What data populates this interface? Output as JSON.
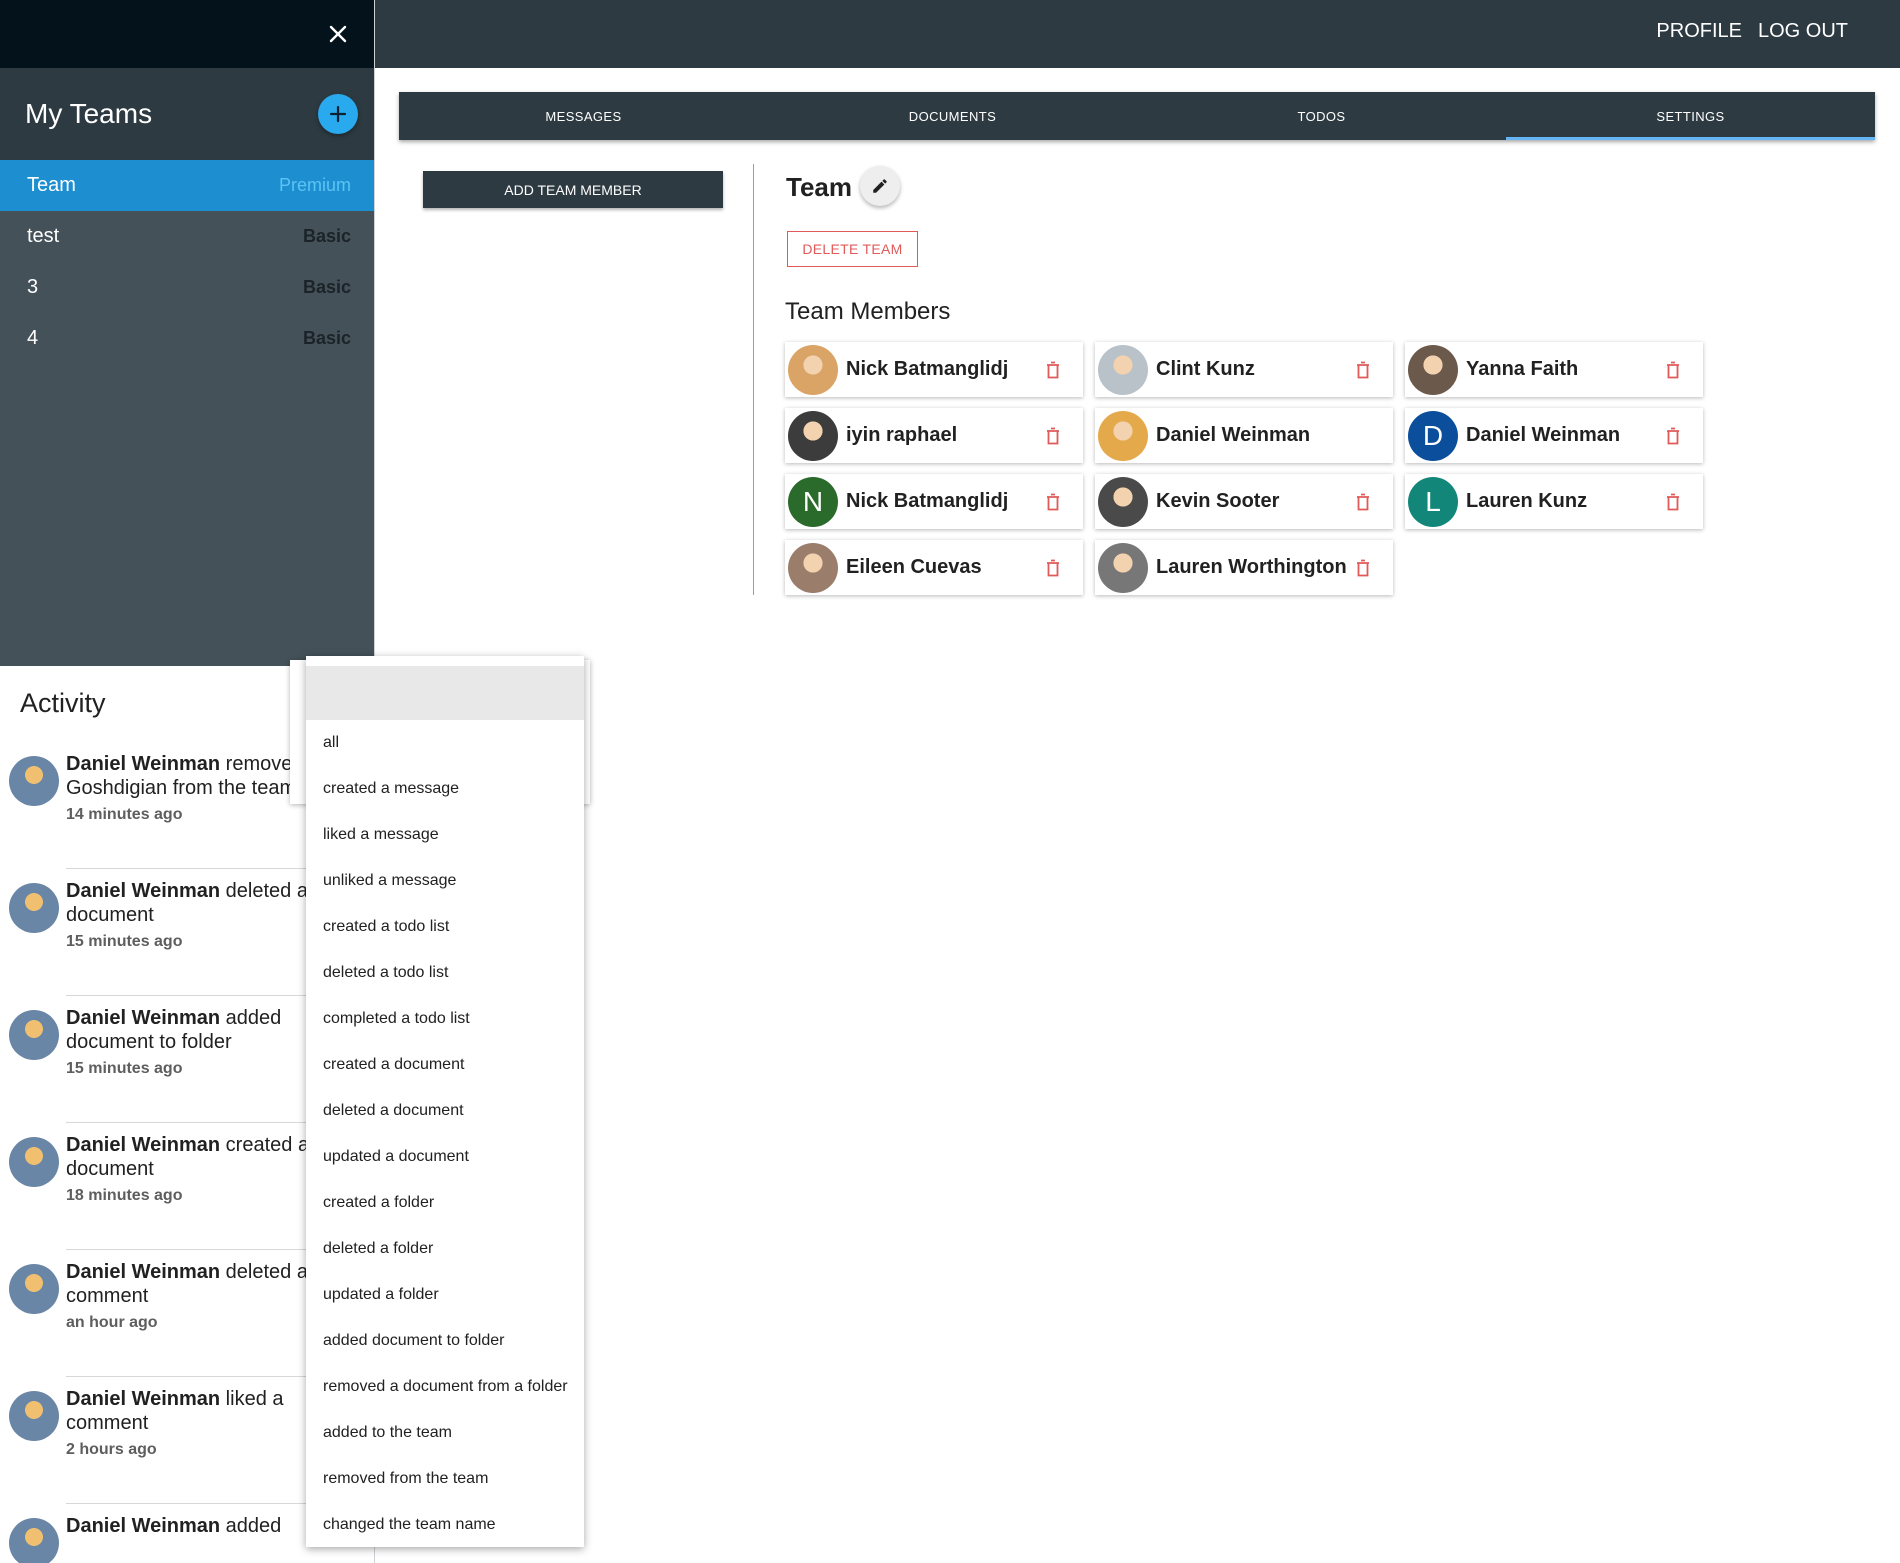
{
  "header": {
    "links": [
      "PROFILE",
      "LOG OUT"
    ]
  },
  "sidebar": {
    "teams_title": "My Teams",
    "teams": [
      {
        "name": "Team",
        "plan": "Premium",
        "active": true
      },
      {
        "name": "test",
        "plan": "Basic",
        "active": false
      },
      {
        "name": "3",
        "plan": "Basic",
        "active": false
      },
      {
        "name": "4",
        "plan": "Basic",
        "active": false
      }
    ],
    "activity_title": "Activity",
    "activity": [
      {
        "user": "Daniel Weinman",
        "text": " removed Mark Goshdigian from the team",
        "time": "14 minutes ago"
      },
      {
        "user": "Daniel Weinman",
        "text": " deleted a document",
        "time": "15 minutes ago"
      },
      {
        "user": "Daniel Weinman",
        "text": " added document to folder",
        "time": "15 minutes ago"
      },
      {
        "user": "Daniel Weinman",
        "text": " created a document",
        "time": "18 minutes ago"
      },
      {
        "user": "Daniel Weinman",
        "text": " deleted a comment",
        "time": "an hour ago"
      },
      {
        "user": "Daniel Weinman",
        "text": " liked a comment",
        "time": "2 hours ago"
      },
      {
        "user": "Daniel Weinman",
        "text": " added",
        "time": ""
      }
    ]
  },
  "tabs": [
    {
      "label": "MESSAGES",
      "active": false
    },
    {
      "label": "DOCUMENTS",
      "active": false
    },
    {
      "label": "TODOS",
      "active": false
    },
    {
      "label": "SETTINGS",
      "active": true
    }
  ],
  "settings": {
    "add_member_label": "ADD TEAM MEMBER",
    "team_name": "Team",
    "delete_team_label": "DELETE TEAM",
    "members_title": "Team Members",
    "members": [
      {
        "name": "Nick Batmanglidj",
        "avatar": "photo",
        "color": "#d9a466",
        "initial": ""
      },
      {
        "name": "Clint Kunz",
        "avatar": "photo",
        "color": "#b9c2c9",
        "initial": ""
      },
      {
        "name": "Yanna Faith",
        "avatar": "photo",
        "color": "#6b5a4c",
        "initial": ""
      },
      {
        "name": "iyin raphael",
        "avatar": "photo",
        "color": "#3c3c3c",
        "initial": ""
      },
      {
        "name": "Daniel Weinman",
        "avatar": "photo",
        "color": "#e4a94a",
        "initial": ""
      },
      {
        "name": "Daniel Weinman",
        "avatar": "letter",
        "color": "#0b4f9c",
        "initial": "D"
      },
      {
        "name": "Nick Batmanglidj",
        "avatar": "letter",
        "color": "#2a6a2a",
        "initial": "N"
      },
      {
        "name": "Kevin Sooter",
        "avatar": "photo",
        "color": "#4a4a4a",
        "initial": ""
      },
      {
        "name": "Lauren Kunz",
        "avatar": "letter",
        "color": "#13867a",
        "initial": "L"
      },
      {
        "name": "Eileen Cuevas",
        "avatar": "photo",
        "color": "#9a7d6b",
        "initial": ""
      },
      {
        "name": "Lauren Worthington",
        "avatar": "photo",
        "color": "#777777",
        "initial": ""
      }
    ],
    "member_delete_enabled": [
      true,
      true,
      true,
      true,
      false,
      true,
      true,
      true,
      true,
      true,
      true
    ]
  },
  "filter_dropdown": {
    "selected": "",
    "options": [
      "all",
      "created a message",
      "liked a message",
      "unliked a message",
      "created a todo list",
      "deleted a todo list",
      "completed a todo list",
      "created a document",
      "deleted a document",
      "updated a document",
      "created a folder",
      "deleted a folder",
      "updated a folder",
      "added document to folder",
      "removed a document from a folder",
      "added to the team",
      "removed from the team",
      "changed the team name"
    ]
  },
  "colors": {
    "dark": "#2d3a41",
    "accent_blue": "#29a9ee",
    "active_team": "#1d8fd0",
    "danger": "#e05a5a"
  }
}
